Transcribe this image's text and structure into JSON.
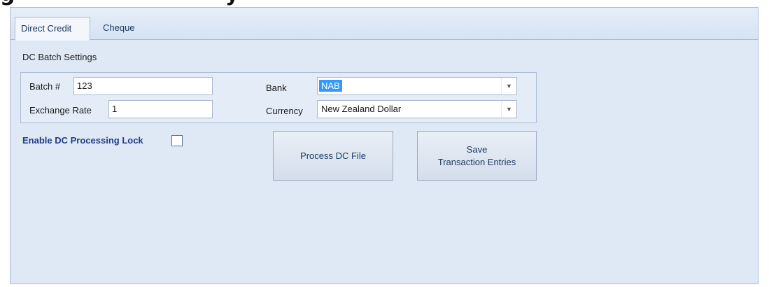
{
  "top_heading": {
    "left_part": "g",
    "right_part": "y"
  },
  "tabs": [
    {
      "label": "Direct Credit",
      "active": true
    },
    {
      "label": "Cheque",
      "active": false
    }
  ],
  "panel": {
    "title": "DC Batch Settings"
  },
  "batch": {
    "batch_label": "Batch #",
    "batch_value": "123",
    "exchange_label": "Exchange Rate",
    "exchange_value": "1",
    "bank_label": "Bank",
    "bank_value": "NAB",
    "currency_label": "Currency",
    "currency_value": "New Zealand Dollar"
  },
  "lock": {
    "label": "Enable DC Processing Lock",
    "checked": false
  },
  "buttons": {
    "process_label": "Process DC File",
    "save_line1": "Save",
    "save_line2": "Transaction Entries"
  },
  "colors": {
    "accent": "#1e3f86",
    "selection": "#3399ff",
    "frame_border": "#a7bad6",
    "panel_bg": "#dfe9f5"
  },
  "icons": {
    "dropdown": "chevron-down-icon"
  }
}
